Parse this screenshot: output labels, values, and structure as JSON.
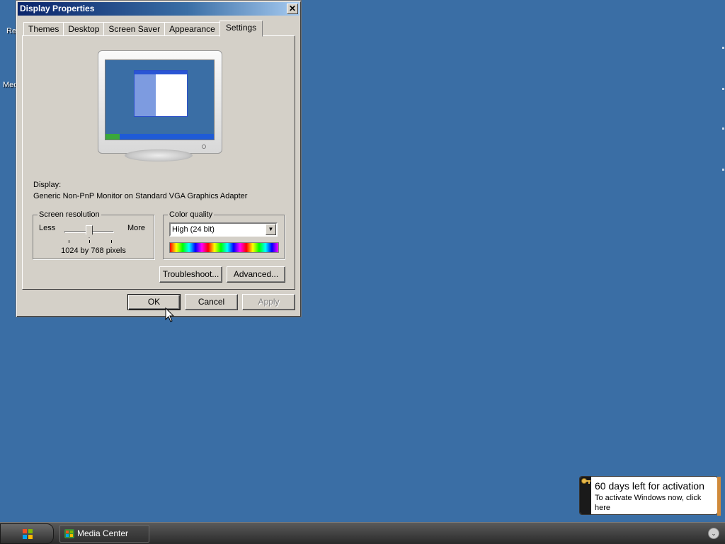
{
  "desktop": {
    "icons": [
      {
        "label": "Re"
      },
      {
        "label": "Med"
      }
    ]
  },
  "dialog": {
    "title": "Display Properties",
    "close_label": "✕",
    "tabs": [
      {
        "label": "Themes",
        "active": false
      },
      {
        "label": "Desktop",
        "active": false
      },
      {
        "label": "Screen Saver",
        "active": false
      },
      {
        "label": "Appearance",
        "active": false
      },
      {
        "label": "Settings",
        "active": true
      }
    ],
    "display_label": "Display:",
    "display_value": "Generic Non-PnP Monitor on Standard VGA Graphics Adapter",
    "screen_resolution": {
      "title": "Screen resolution",
      "less_label": "Less",
      "more_label": "More",
      "value_text": "1024 by 768 pixels"
    },
    "color_quality": {
      "title": "Color quality",
      "selected": "High (24 bit)"
    },
    "buttons": {
      "troubleshoot": "Troubleshoot...",
      "advanced": "Advanced...",
      "ok": "OK",
      "cancel": "Cancel",
      "apply": "Apply"
    }
  },
  "balloon": {
    "title": "60 days left for activation",
    "text": "To activate Windows now, click here"
  },
  "taskbar": {
    "task_label": "Media Center",
    "tray_chevron": "⌄"
  },
  "colors": {
    "desktop": "#3a6ea5",
    "dialog_face": "#d4d0c8",
    "title_gradient_start": "#0a246a"
  }
}
